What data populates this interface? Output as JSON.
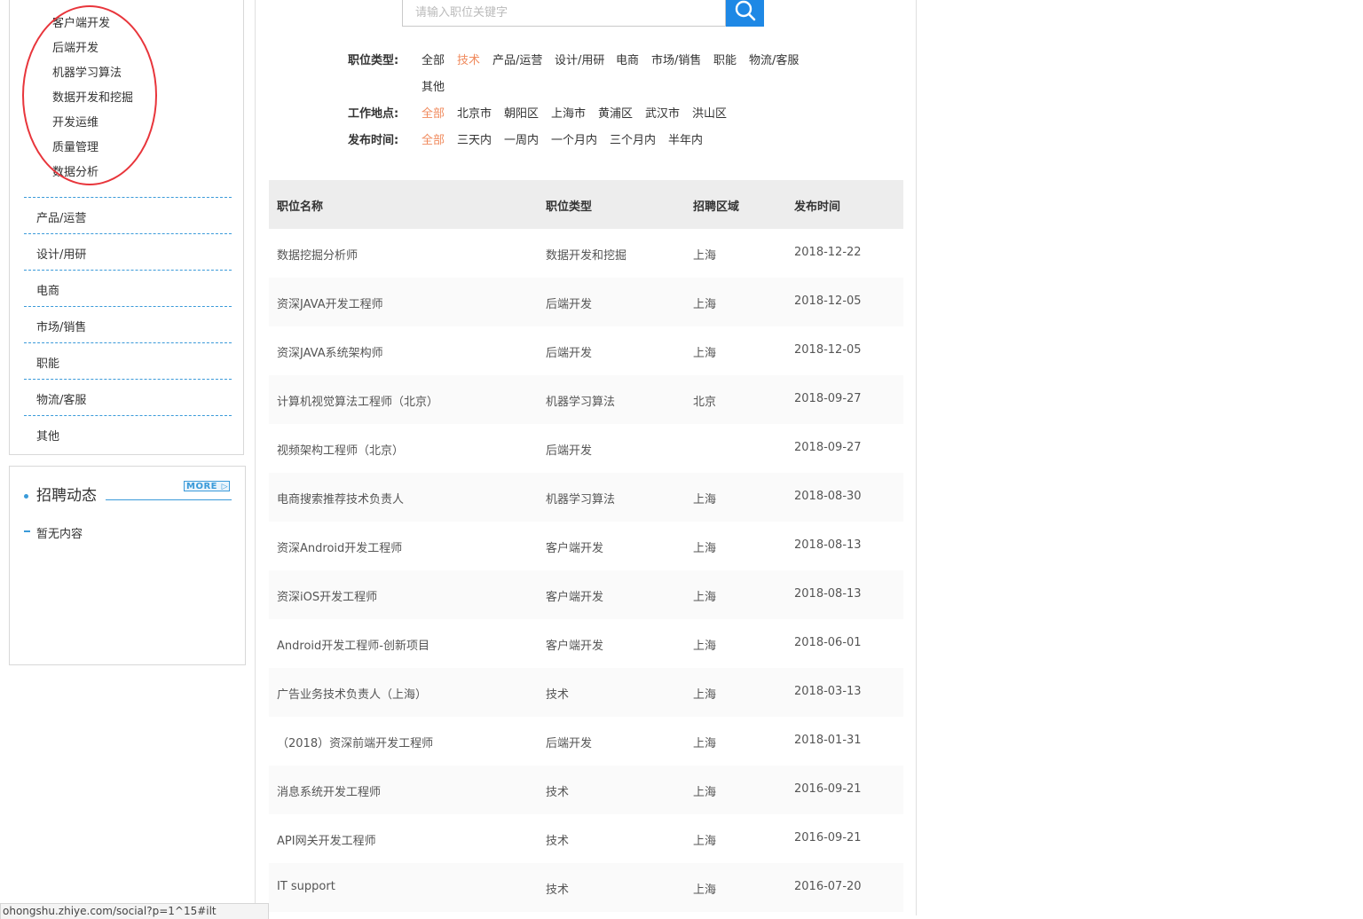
{
  "sidebar": {
    "sub_categories": [
      "客户端开发",
      "后端开发",
      "机器学习算法",
      "数据开发和挖掘",
      "开发运维",
      "质量管理",
      "数据分析"
    ],
    "categories": [
      "产品/运营",
      "设计/用研",
      "电商",
      "市场/销售",
      "职能",
      "物流/客服",
      "其他"
    ]
  },
  "news": {
    "title": "招聘动态",
    "more_label": "MORE",
    "empty_text": "暂无内容"
  },
  "search": {
    "placeholder": "请输入职位关键字",
    "icon": "search-icon"
  },
  "filters": {
    "job_type": {
      "label": "职位类型:",
      "options": [
        "全部",
        "技术",
        "产品/运营",
        "设计/用研",
        "电商",
        "市场/销售",
        "职能",
        "物流/客服",
        "其他"
      ],
      "selected": "技术"
    },
    "location": {
      "label": "工作地点:",
      "options": [
        "全部",
        "北京市",
        "朝阳区",
        "上海市",
        "黄浦区",
        "武汉市",
        "洪山区"
      ],
      "selected": "全部"
    },
    "post_time": {
      "label": "发布时间:",
      "options": [
        "全部",
        "三天内",
        "一周内",
        "一个月内",
        "三个月内",
        "半年内"
      ],
      "selected": "全部"
    }
  },
  "table": {
    "headers": [
      "职位名称",
      "职位类型",
      "招聘区域",
      "发布时间"
    ],
    "rows": [
      [
        "数据挖掘分析师",
        "数据开发和挖掘",
        "上海",
        "2018-12-22"
      ],
      [
        "资深JAVA开发工程师",
        "后端开发",
        "上海",
        "2018-12-05"
      ],
      [
        "资深JAVA系统架构师",
        "后端开发",
        "上海",
        "2018-12-05"
      ],
      [
        "计算机视觉算法工程师（北京）",
        "机器学习算法",
        "北京",
        "2018-09-27"
      ],
      [
        "视频架构工程师（北京）",
        "后端开发",
        "",
        "2018-09-27"
      ],
      [
        "电商搜索推荐技术负责人",
        "机器学习算法",
        "上海",
        "2018-08-30"
      ],
      [
        "资深Android开发工程师",
        "客户端开发",
        "上海",
        "2018-08-13"
      ],
      [
        "资深iOS开发工程师",
        "客户端开发",
        "上海",
        "2018-08-13"
      ],
      [
        "Android开发工程师-创新项目",
        "客户端开发",
        "上海",
        "2018-06-01"
      ],
      [
        "广告业务技术负责人（上海）",
        "技术",
        "上海",
        "2018-03-13"
      ],
      [
        "（2018）资深前端开发工程师",
        "后端开发",
        "上海",
        "2018-01-31"
      ],
      [
        "消息系统开发工程师",
        "技术",
        "上海",
        "2016-09-21"
      ],
      [
        "API网关开发工程师",
        "技术",
        "上海",
        "2016-09-21"
      ],
      [
        "IT support",
        "技术",
        "上海",
        "2016-07-20"
      ]
    ]
  },
  "status_bar": {
    "url": "ohongshu.zhiye.com/social?p=1^15#ilt"
  },
  "colors": {
    "accent_blue": "#3a9ad9",
    "search_button": "#1e88e5",
    "active_filter": "#f08a5d",
    "annotation_circle": "#e8353b"
  }
}
